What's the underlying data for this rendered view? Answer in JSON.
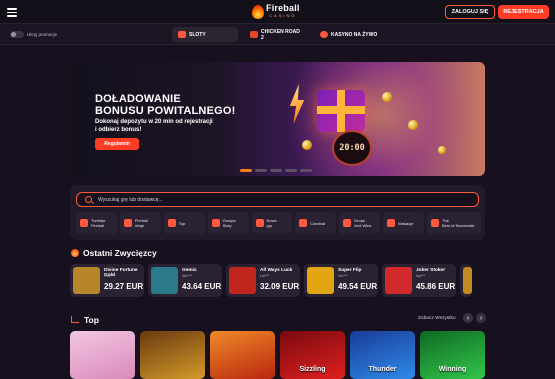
{
  "header": {
    "logo_main": "Fireball",
    "logo_sub": "CASINO",
    "login_label": "ZALOGUJ SIĘ",
    "register_label": "REJESTRACJA"
  },
  "subnav": {
    "promo_toggle_label": "Ukryj promocje",
    "tabs": [
      {
        "label": "SLOTY",
        "icon": "slots-icon",
        "active": true
      },
      {
        "label": "CHICKEN ROAD 2",
        "icon": "chicken-icon",
        "active": false
      },
      {
        "label": "KASYNO NA ŻYWO",
        "icon": "live-casino-icon",
        "active": false
      }
    ]
  },
  "hero": {
    "title_line1": "DOŁADOWANIE",
    "title_line2": "BONUSU POWITALNEGO!",
    "subtitle_line1": "Dokonaj depozytu w 20 min od rejestracji",
    "subtitle_line2": "i odbierz bonus!",
    "button_label": "Regulamin",
    "clock_text": "20:00",
    "slide_count": 5,
    "active_slide": 1
  },
  "search": {
    "placeholder": "Wyszukaj grę lub dostawcę..."
  },
  "categories": [
    {
      "line1": "Turnieje",
      "line2": "Fireball",
      "icon": "trophy-icon"
    },
    {
      "line1": "Fireball",
      "line2": "misje",
      "icon": "missions-icon"
    },
    {
      "line1": "Top",
      "line2": "",
      "icon": "top-chart-icon"
    },
    {
      "line1": "Gorące",
      "line2": "Sloty",
      "icon": "lightning-icon"
    },
    {
      "line1": "Nowe",
      "line2": "gry",
      "icon": "new-badge-icon"
    },
    {
      "line1": "Carnival",
      "line2": "",
      "icon": "carnival-icon"
    },
    {
      "line1": "Drops",
      "line2": "And Wins",
      "icon": "drops-icon"
    },
    {
      "line1": "Wakacje",
      "line2": "",
      "icon": "vacation-icon"
    },
    {
      "line1": "The",
      "line2": "Best of Novomatic",
      "icon": "star-icon"
    }
  ],
  "winners_section": {
    "title": "Ostatni Zwycięzcy",
    "items": [
      {
        "game": "Divine Fortune Gold",
        "user": "Gob***",
        "amount": "29.27 EUR",
        "color": "#b8862a"
      },
      {
        "game": "Gemix",
        "user": "Ale***",
        "amount": "43.64 EUR",
        "color": "#2b7a8a"
      },
      {
        "game": "All Ways Luck",
        "user": "Lei***",
        "amount": "32.09 EUR",
        "color": "#c0261d"
      },
      {
        "game": "Super Flip",
        "user": "Vic***",
        "amount": "49.54 EUR",
        "color": "#e2a512"
      },
      {
        "game": "Joker Stoker",
        "user": "lay***",
        "amount": "45.86 EUR",
        "color": "#d22a2a"
      }
    ]
  },
  "top_section": {
    "title": "Top",
    "see_all_label": "Zobacz Wszystko",
    "prev_icon": "chevron-left-icon",
    "next_icon": "chevron-right-icon",
    "games": [
      {
        "label": "",
        "color": "#e7a7d0"
      },
      {
        "label": "",
        "color": "#b87a1a"
      },
      {
        "label": "",
        "color": "#d8491c"
      },
      {
        "label": "Sizzling",
        "color": "#c2121a"
      },
      {
        "label": "Thunder",
        "color": "#1f5fd6"
      },
      {
        "label": "Winning",
        "color": "#1fae3a"
      }
    ]
  }
}
